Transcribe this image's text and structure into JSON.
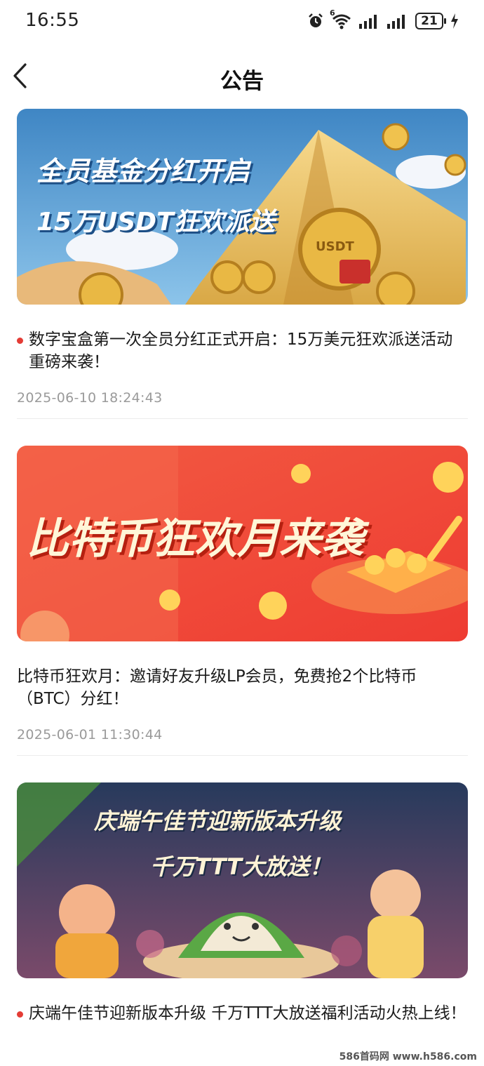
{
  "status_bar": {
    "time": "16:55",
    "network_tag": "6",
    "battery": "21"
  },
  "header": {
    "title": "公告",
    "back_icon": "chevron-left-icon"
  },
  "announcements": [
    {
      "banner_line1": "全员基金分红开启",
      "banner_line2": "15万USDT狂欢派送",
      "banner_coin_text": "USDT",
      "has_dot": true,
      "title": "数字宝盒第一次全员分红正式开启：15万美元狂欢派送活动重磅来袭！",
      "date": "2025-06-10 18:24:43"
    },
    {
      "banner_line1": "比特币狂欢月来袭",
      "has_dot": false,
      "title": "比特币狂欢月：邀请好友升级LP会员，免费抢2个比特币（BTC）分红！",
      "date": "2025-06-01 11:30:44"
    },
    {
      "banner_line1": "庆端午佳节迎新版本升级",
      "banner_line2": "千万TTT大放送！",
      "has_dot": true,
      "title": "庆端午佳节迎新版本升级  千万TTT大放送福利活动火热上线！"
    }
  ],
  "watermark": "586首码网 www.h586.com",
  "colors": {
    "accent_dot": "#e43c35",
    "date_gray": "#9a9a9a"
  }
}
